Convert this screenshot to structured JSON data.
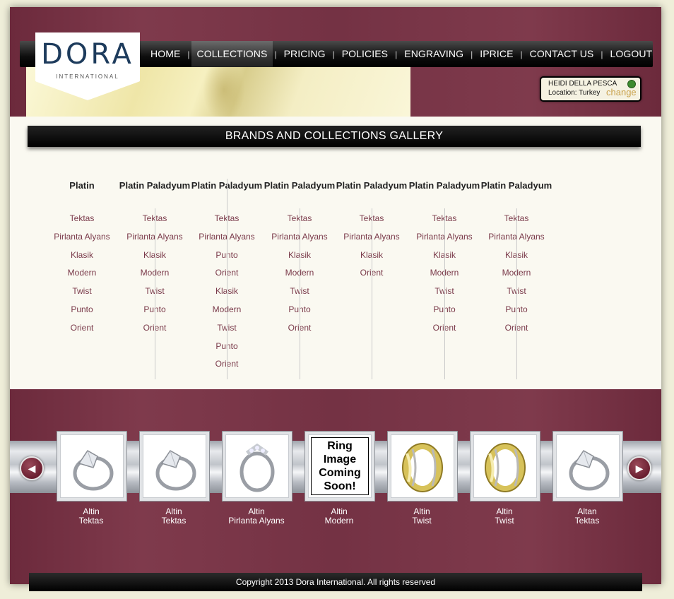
{
  "logo": {
    "name": "DORA",
    "sub": "INTERNATIONAL"
  },
  "nav": [
    {
      "label": "HOME"
    },
    {
      "label": "COLLECTIONS",
      "active": true
    },
    {
      "label": "PRICING"
    },
    {
      "label": "POLICIES"
    },
    {
      "label": "ENGRAVING"
    },
    {
      "label": "IPRICE"
    },
    {
      "label": "CONTACT US"
    },
    {
      "label": "LOGOUT"
    }
  ],
  "nav_separator": "|",
  "user": {
    "name": "HEIDI DELLA PESCA",
    "location": "Location: Turkey",
    "change": "change",
    "status_color": "#3d8b2f"
  },
  "gallery": {
    "title": "BRANDS AND COLLECTIONS GALLERY",
    "columns": [
      {
        "title": "Platin",
        "links": [
          "Tektas",
          "Pirlanta Alyans",
          "Klasik",
          "Modern",
          "Twist",
          "Punto",
          "Orient"
        ]
      },
      {
        "title": "Platin Paladyum",
        "links": [
          "Tektas",
          "Pirlanta Alyans",
          "Klasik",
          "Modern",
          "Twist",
          "Punto",
          "Orient"
        ]
      },
      {
        "title": "Platin Paladyum",
        "links": [
          "Tektas",
          "Pirlanta Alyans",
          "Punto",
          "Orient",
          "Klasik",
          "Modern",
          "Twist",
          "Punto",
          "Orient"
        ]
      },
      {
        "title": "Platin Paladyum",
        "links": [
          "Tektas",
          "Pirlanta Alyans",
          "Klasik",
          "Modern",
          "Twist",
          "Punto",
          "Orient"
        ]
      },
      {
        "title": "Platin Paladyum",
        "links": [
          "Tektas",
          "Pirlanta Alyans",
          "Klasik",
          "Orient"
        ]
      },
      {
        "title": "Platin Paladyum",
        "links": [
          "Tektas",
          "Pirlanta Alyans",
          "Klasik",
          "Modern",
          "Twist",
          "Punto",
          "Orient"
        ]
      },
      {
        "title": "Platin Paladyum",
        "links": [
          "Tektas",
          "Pirlanta Alyans",
          "Klasik",
          "Modern",
          "Twist",
          "Punto",
          "Orient"
        ]
      }
    ]
  },
  "carousel": {
    "prev_icon": "left-arrow-icon",
    "next_icon": "right-arrow-icon",
    "items": [
      {
        "line1": "Altin",
        "line2": "Tektas",
        "image": "white-gold-solitaire-ring"
      },
      {
        "line1": "Altin",
        "line2": "Tektas",
        "image": "white-gold-solitaire-ring"
      },
      {
        "line1": "Altin",
        "line2": "Pirlanta Alyans",
        "image": "white-gold-diamond-band"
      },
      {
        "line1": "Altin",
        "line2": "Modern",
        "image": "placeholder",
        "placeholder_text": "Ring Image Coming Soon!"
      },
      {
        "line1": "Altin",
        "line2": "Twist",
        "image": "yellow-gold-twist-band"
      },
      {
        "line1": "Altin",
        "line2": "Twist",
        "image": "yellow-gold-twist-band"
      },
      {
        "line1": "Altan",
        "line2": "Tektas",
        "image": "white-gold-solitaire-ring"
      }
    ]
  },
  "footer": "Copyright 2013 Dora International. All rights reserved"
}
